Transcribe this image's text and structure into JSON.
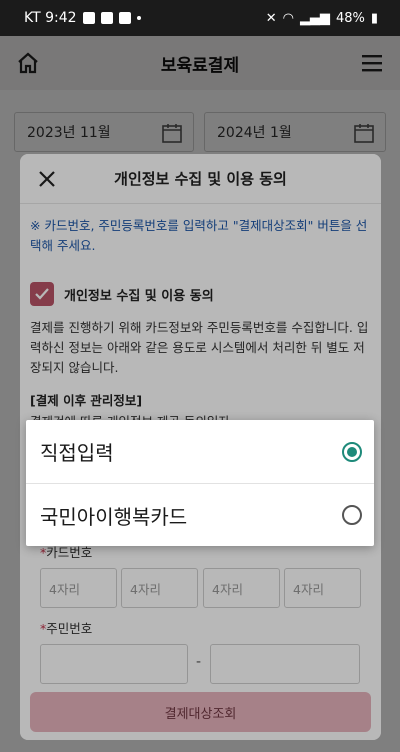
{
  "status_bar": {
    "carrier_time": "KT 9:42",
    "battery": "48%"
  },
  "header": {
    "title": "보육료결제"
  },
  "page": {
    "start_date": "2023년 11월",
    "end_date": "2024년 1월"
  },
  "modal": {
    "title": "개인정보 수집 및 이용 동의",
    "notice": "※ 카드번호, 주민등록번호를 입력하고 \"결제대상조회\" 버튼을 선택해 주세요.",
    "consent_label": "개인정보 수집 및 이용 동의",
    "consent_checked": true,
    "description": "결제를 진행하기 위해 카드정보와 주민등록번호를 수집합니다. 입력하신 정보는 아래와 같은 용도로 시스템에서 처리한 뒤 별도 저장되지 않습니다.",
    "subhead": "[결제 이후 관리정보]",
    "subtext": "결제건에 따른 개인정보 제공 동의일자",
    "card_label": "카드번호",
    "card_placeholders": [
      "4자리",
      "4자리",
      "4자리",
      "4자리"
    ],
    "rrn_label": "주민번호",
    "rrn_separator": "-",
    "search_button": "결제대상조회",
    "accent_color": "#b95467"
  },
  "picker": {
    "options": [
      {
        "label": "직접입력",
        "selected": true
      },
      {
        "label": "국민아이행복카드",
        "selected": false
      }
    ],
    "radio_color": "#1e8a7a"
  }
}
